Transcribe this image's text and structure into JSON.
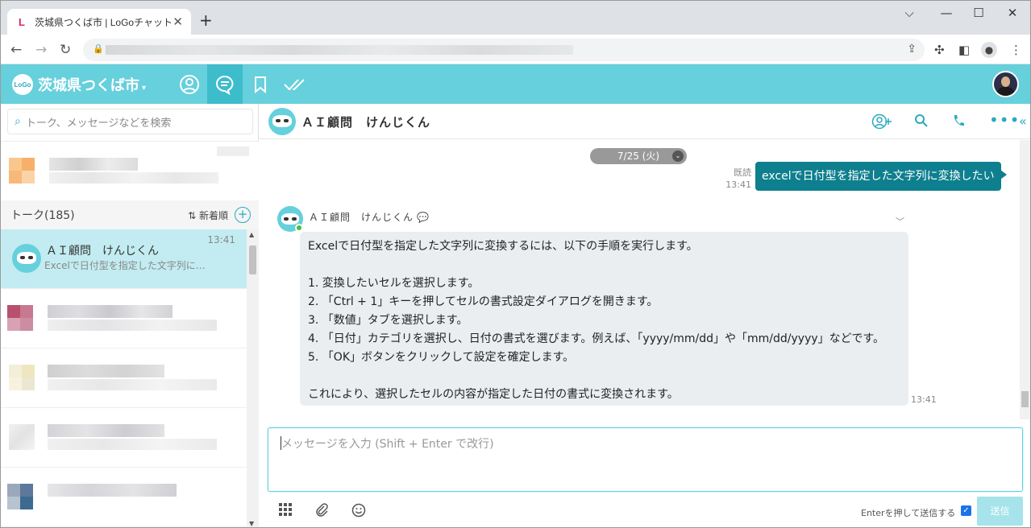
{
  "browser": {
    "tab_favicon": "L",
    "tab_title": "茨城県つくば市 | LoGoチャット",
    "close_glyph": "✕",
    "new_tab_glyph": "+",
    "win_min": "⌵",
    "win_minimize": "—",
    "win_max": "☐",
    "win_close": "✕"
  },
  "app": {
    "logo_text": "LoGo",
    "org_name": "茨城県つくば市",
    "org_caret": "▾"
  },
  "sidebar": {
    "search_placeholder": "トーク、メッセージなどを検索",
    "talk_header": "トーク(185)",
    "sort_label": "⇅ 新着順",
    "add_glyph": "+",
    "items": [
      {
        "name": "ＡＩ顧問　けんじくん",
        "preview": "Excelで日付型を指定した文字列に…",
        "time": "13:41"
      }
    ]
  },
  "chat": {
    "title": "ＡＩ顧問　けんじくん",
    "date_divider": "7/25 (火)",
    "date_caret": "⌄",
    "my_message": {
      "read_label": "既読",
      "time": "13:41",
      "text": "excelで日付型を指定した文字列に変換したい"
    },
    "bot_message": {
      "sender": "ＡＩ顧問　けんじくん",
      "lines": [
        "Excelで日付型を指定した文字列に変換するには、以下の手順を実行します。",
        "",
        "1. 変換したいセルを選択します。",
        "2. 「Ctrl + 1」キーを押してセルの書式設定ダイアログを開きます。",
        "3. 「数値」タブを選択します。",
        "4. 「日付」カテゴリを選択し、日付の書式を選びます。例えば、「yyyy/mm/dd」や「mm/dd/yyyy」などです。",
        "5. 「OK」ボタンをクリックして設定を確定します。",
        "",
        "これにより、選択したセルの内容が指定した日付の書式に変換されます。"
      ],
      "time": "13:41"
    },
    "input_placeholder": "メッセージを入力 (Shift + Enter で改行)",
    "enter_option_label": "Enterを押して送信する",
    "send_label": "送信"
  },
  "colors": {
    "header_bg": "#66d0dc",
    "accent": "#2aa9bf",
    "my_bubble": "#0e7f8e",
    "selected_row": "#c2ecf1"
  }
}
